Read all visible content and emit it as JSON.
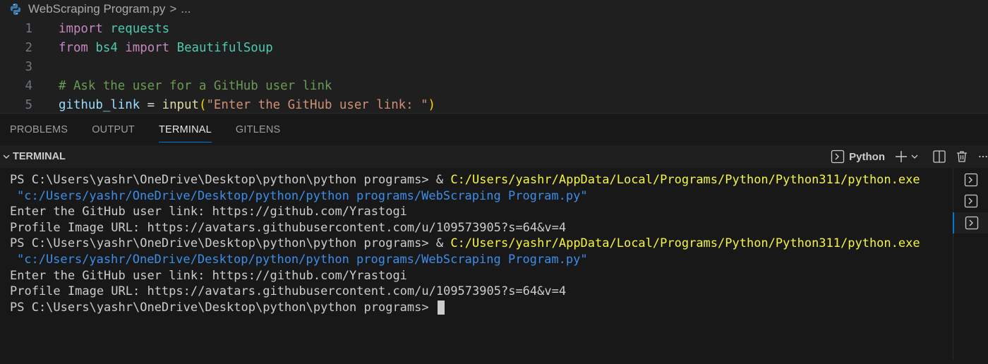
{
  "editor": {
    "breadcrumb": {
      "file_name": "WebScraping Program.py",
      "separator": ">",
      "ellipsis": "..."
    },
    "lines": [
      {
        "number": "1",
        "tokens": [
          {
            "t": "import",
            "c": "kw-import"
          },
          {
            "t": " ",
            "c": "plain"
          },
          {
            "t": "requests",
            "c": "mod"
          }
        ]
      },
      {
        "number": "2",
        "tokens": [
          {
            "t": "from",
            "c": "kw-import"
          },
          {
            "t": " ",
            "c": "plain"
          },
          {
            "t": "bs4",
            "c": "mod"
          },
          {
            "t": " ",
            "c": "plain"
          },
          {
            "t": "import",
            "c": "kw-import"
          },
          {
            "t": " ",
            "c": "plain"
          },
          {
            "t": "BeautifulSoup",
            "c": "mod"
          }
        ]
      },
      {
        "number": "3",
        "tokens": []
      },
      {
        "number": "4",
        "tokens": [
          {
            "t": "# Ask the user for a GitHub user link",
            "c": "cmt"
          }
        ]
      },
      {
        "number": "5",
        "tokens": [
          {
            "t": "github_link",
            "c": "var"
          },
          {
            "t": " = ",
            "c": "plain"
          },
          {
            "t": "input",
            "c": "fn"
          },
          {
            "t": "(",
            "c": "paren"
          },
          {
            "t": "\"Enter the GitHub user link: \"",
            "c": "str"
          },
          {
            "t": ")",
            "c": "paren"
          }
        ]
      }
    ]
  },
  "panel": {
    "tabs": [
      {
        "label": "PROBLEMS",
        "active": false
      },
      {
        "label": "OUTPUT",
        "active": false
      },
      {
        "label": "TERMINAL",
        "active": true
      },
      {
        "label": "GITLENS",
        "active": false
      }
    ]
  },
  "terminal": {
    "title": "TERMINAL",
    "profile_label": "Python",
    "lines": [
      {
        "indent": false,
        "segments": [
          {
            "t": "PS C:\\Users\\yashr\\OneDrive\\Desktop\\python\\python programs> & ",
            "c": ""
          },
          {
            "t": "C:/Users/yashr/AppData/Local/Programs/Python/Python311/python.exe",
            "c": "t-yellow"
          }
        ]
      },
      {
        "indent": true,
        "segments": [
          {
            "t": "\"c:/Users/yashr/OneDrive/Desktop/python/python programs/WebScraping Program.py\"",
            "c": "t-blue"
          }
        ]
      },
      {
        "indent": false,
        "segments": [
          {
            "t": "Enter the GitHub user link: https://github.com/Yrastogi",
            "c": ""
          }
        ]
      },
      {
        "indent": false,
        "segments": [
          {
            "t": "Profile Image URL: https://avatars.githubusercontent.com/u/109573905?s=64&v=4",
            "c": ""
          }
        ]
      },
      {
        "indent": false,
        "segments": [
          {
            "t": "PS C:\\Users\\yashr\\OneDrive\\Desktop\\python\\python programs> & ",
            "c": ""
          },
          {
            "t": "C:/Users/yashr/AppData/Local/Programs/Python/Python311/python.exe",
            "c": "t-yellow"
          }
        ]
      },
      {
        "indent": true,
        "segments": [
          {
            "t": "\"c:/Users/yashr/OneDrive/Desktop/python/python programs/WebScraping Program.py\"",
            "c": "t-blue"
          }
        ]
      },
      {
        "indent": false,
        "segments": [
          {
            "t": "Enter the GitHub user link: https://github.com/Yrastogi",
            "c": ""
          }
        ]
      },
      {
        "indent": false,
        "segments": [
          {
            "t": "Profile Image URL: https://avatars.githubusercontent.com/u/109573905?s=64&v=4",
            "c": ""
          }
        ]
      },
      {
        "indent": false,
        "cursor": true,
        "segments": [
          {
            "t": "PS C:\\Users\\yashr\\OneDrive\\Desktop\\python\\python programs> ",
            "c": ""
          }
        ]
      }
    ],
    "instances": [
      {
        "icon": "terminal-icon",
        "selected": false
      },
      {
        "icon": "terminal-icon",
        "selected": false
      },
      {
        "icon": "terminal-icon",
        "selected": true
      }
    ]
  },
  "colors": {
    "accent": "#0078d4",
    "path_yellow": "#f5f543",
    "path_blue": "#3b8eea"
  }
}
